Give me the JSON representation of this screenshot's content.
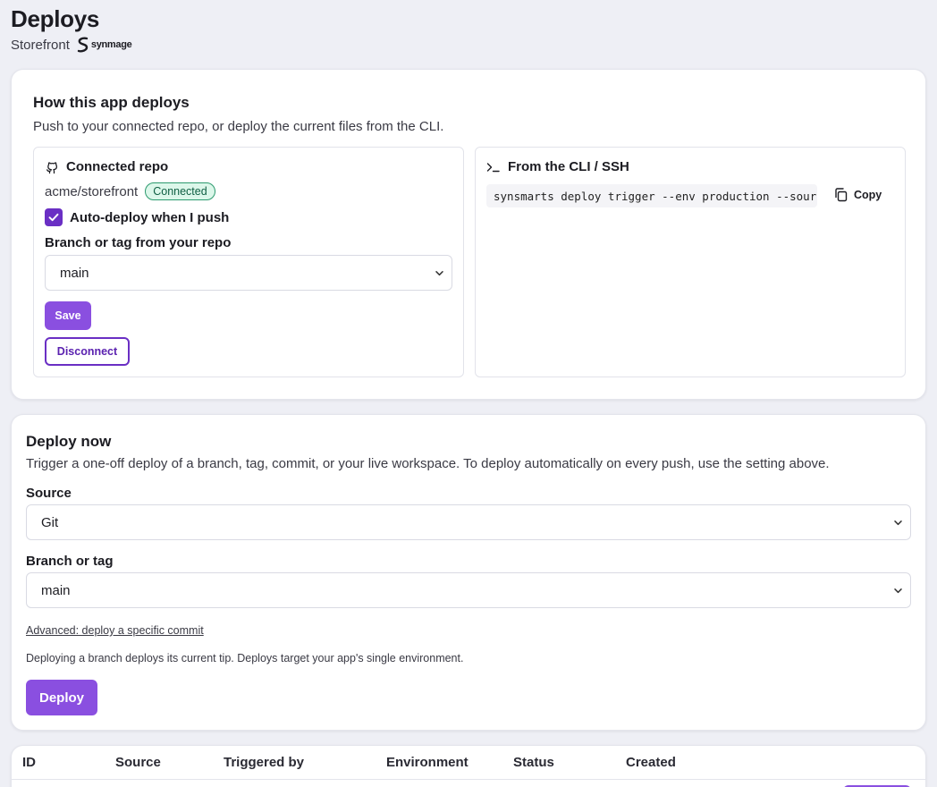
{
  "header": {
    "title": "Deploys",
    "app_name": "Storefront",
    "brand": "synmage"
  },
  "how": {
    "title": "How this app deploys",
    "description": "Push to your connected repo, or deploy the current files from the CLI.",
    "repo_panel": {
      "title": "Connected repo",
      "repo": "acme/storefront",
      "status": "Connected",
      "auto_deploy_label": "Auto-deploy when I push",
      "auto_deploy_checked": true,
      "branch_label": "Branch or tag from your repo",
      "branch_value": "main",
      "save_label": "Save",
      "disconnect_label": "Disconnect"
    },
    "cli_panel": {
      "title": "From the CLI / SSH",
      "command": "synsmarts deploy trigger --env production --source",
      "copy_label": "Copy"
    }
  },
  "deploy_now": {
    "title": "Deploy now",
    "description": "Trigger a one-off deploy of a branch, tag, commit, or your live workspace. To deploy automatically on every push, use the setting above.",
    "source_label": "Source",
    "source_value": "Git",
    "branch_label": "Branch or tag",
    "branch_value": "main",
    "advanced_link": "Advanced: deploy a specific commit",
    "note": "Deploying a branch deploys its current tip. Deploys target your app's single environment.",
    "deploy_label": "Deploy"
  },
  "table": {
    "columns": [
      "ID",
      "Source",
      "Triggered by",
      "Environment",
      "Status",
      "Created"
    ]
  },
  "colors": {
    "accent": "#8a4fe0",
    "accent_dark": "#6a2fc4",
    "success_bg": "#dcf7ea",
    "success_border": "#2c9a6e"
  }
}
